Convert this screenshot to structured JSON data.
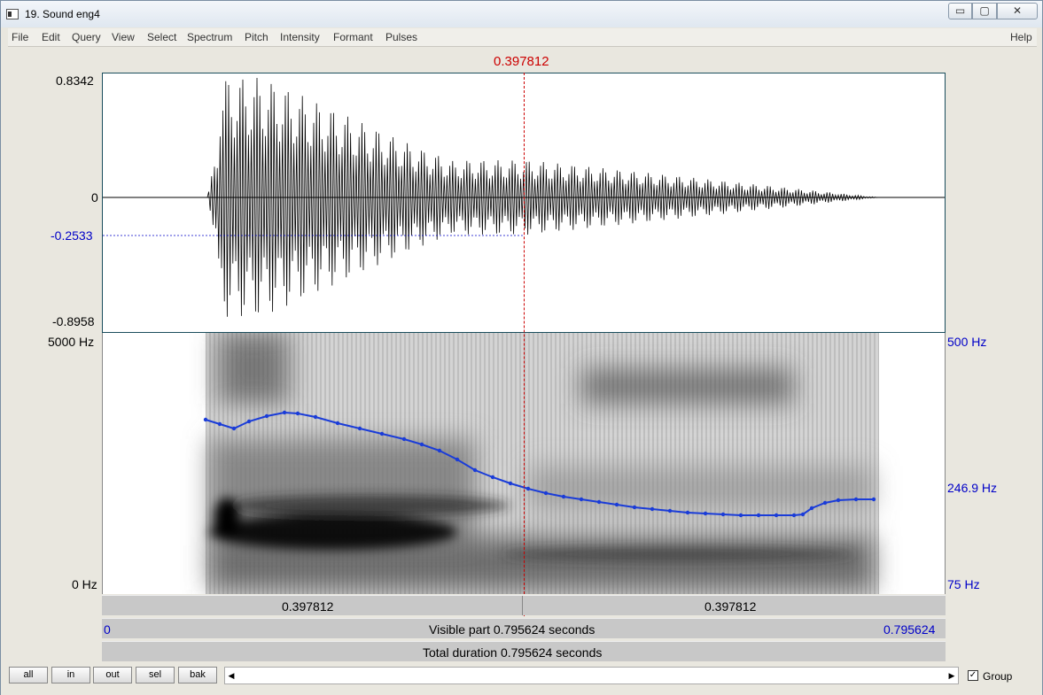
{
  "window": {
    "title": "19. Sound eng4",
    "min": "▭",
    "max": "▢",
    "close": "✕"
  },
  "menu": [
    "File",
    "Edit",
    "Query",
    "View",
    "Select",
    "Spectrum",
    "Pitch",
    "Intensity",
    "Formant",
    "Pulses"
  ],
  "help": "Help",
  "cursor_time": "0.397812",
  "waveform": {
    "max": "0.8342",
    "zero": "0",
    "cursor_value": "-0.2533",
    "min": "-0.8958"
  },
  "spectrogram": {
    "top": "5000 Hz",
    "bottom": "0 Hz"
  },
  "pitch": {
    "top": "500 Hz",
    "cursor": "246.9 Hz",
    "bottom": "75 Hz"
  },
  "time_bar": {
    "left": "0.397812",
    "right": "0.397812"
  },
  "visible_bar": {
    "start": "0",
    "label": "Visible part 0.795624 seconds",
    "end": "0.795624"
  },
  "total_bar": {
    "label": "Total duration 0.795624 seconds"
  },
  "buttons": {
    "all": "all",
    "in": "in",
    "out": "out",
    "sel": "sel",
    "bak": "bak"
  },
  "group": {
    "label": "Group",
    "checked": "✓"
  },
  "scroll": {
    "left": "◀",
    "right": "▶"
  },
  "colors": {
    "pitch_line": "#1a3cd8",
    "cursor": "#cc0000",
    "axis_blue": "#0000c8"
  }
}
